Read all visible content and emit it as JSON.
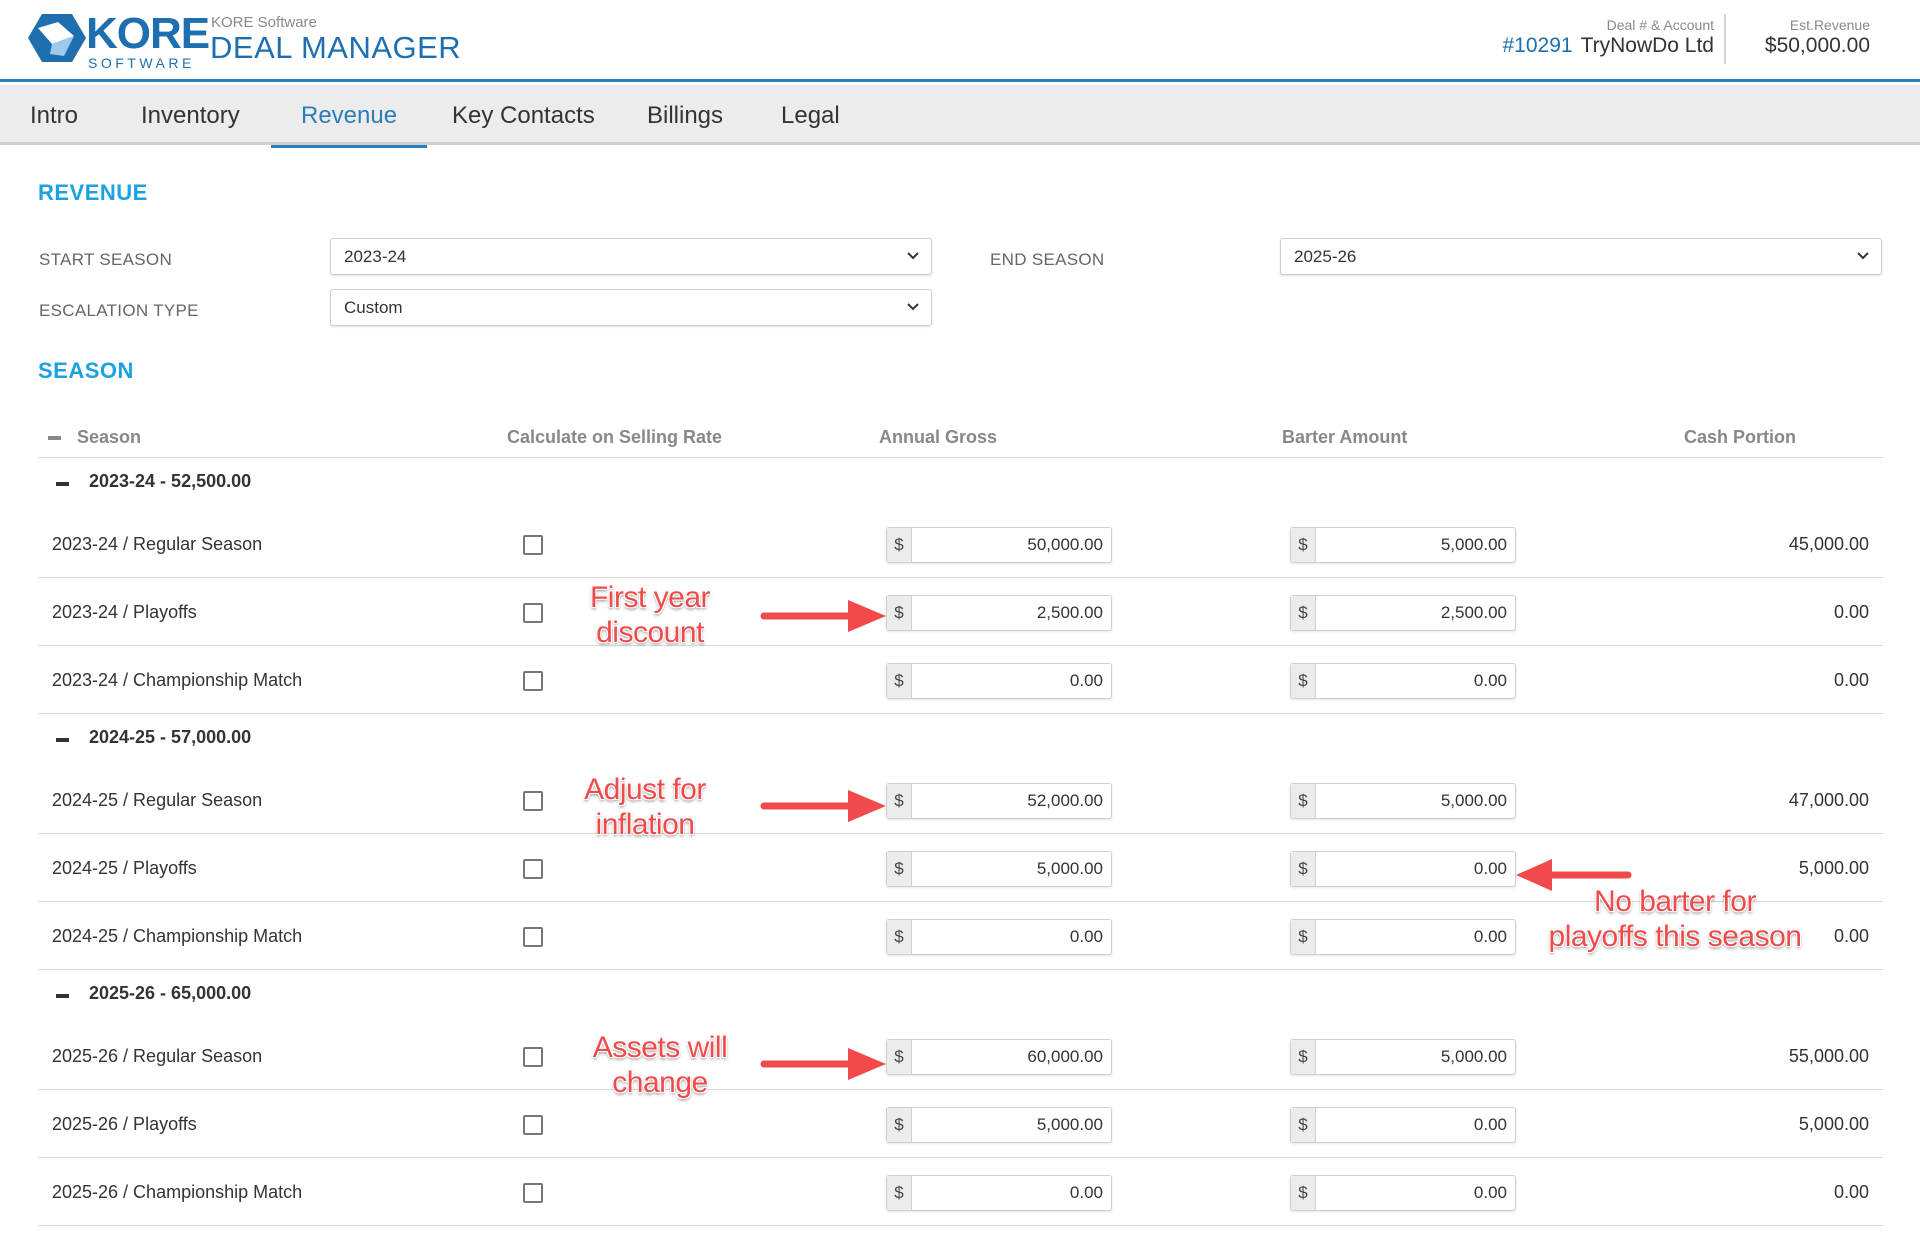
{
  "header": {
    "logo_text": "KORE",
    "logo_sub": "SOFTWARE",
    "app_sub": "KORE Software",
    "app_title": "DEAL MANAGER",
    "deal_label": "Deal # & Account",
    "deal_number": "#10291",
    "deal_account": "TryNowDo Ltd",
    "revenue_label": "Est.Revenue",
    "revenue_value": "$50,000.00"
  },
  "tabs": [
    {
      "label": "Intro"
    },
    {
      "label": "Inventory"
    },
    {
      "label": "Revenue",
      "active": true
    },
    {
      "label": "Key Contacts"
    },
    {
      "label": "Billings"
    },
    {
      "label": "Legal"
    }
  ],
  "revenue": {
    "title": "REVENUE",
    "start_season_label": "START SEASON",
    "start_season_value": "2023-24",
    "end_season_label": "END SEASON",
    "end_season_value": "2025-26",
    "escalation_label": "ESCALATION TYPE",
    "escalation_value": "Custom"
  },
  "season": {
    "title": "SEASON",
    "columns": {
      "season": "Season",
      "calc": "Calculate on Selling Rate",
      "gross": "Annual Gross",
      "barter": "Barter Amount",
      "cash": "Cash Portion"
    },
    "currency": "$",
    "groups": [
      {
        "label": "2023-24 - 52,500.00",
        "rows": [
          {
            "name": "2023-24 / Regular Season",
            "gross": "50,000.00",
            "barter": "5,000.00",
            "cash": "45,000.00"
          },
          {
            "name": "2023-24 / Playoffs",
            "gross": "2,500.00",
            "barter": "2,500.00",
            "cash": "0.00"
          },
          {
            "name": "2023-24 / Championship Match",
            "gross": "0.00",
            "barter": "0.00",
            "cash": "0.00"
          }
        ]
      },
      {
        "label": "2024-25 - 57,000.00",
        "rows": [
          {
            "name": "2024-25 / Regular Season",
            "gross": "52,000.00",
            "barter": "5,000.00",
            "cash": "47,000.00"
          },
          {
            "name": "2024-25 / Playoffs",
            "gross": "5,000.00",
            "barter": "0.00",
            "cash": "5,000.00"
          },
          {
            "name": "2024-25 / Championship Match",
            "gross": "0.00",
            "barter": "0.00",
            "cash": "0.00"
          }
        ]
      },
      {
        "label": "2025-26 - 65,000.00",
        "rows": [
          {
            "name": "2025-26 / Regular Season",
            "gross": "60,000.00",
            "barter": "5,000.00",
            "cash": "55,000.00"
          },
          {
            "name": "2025-26 / Playoffs",
            "gross": "5,000.00",
            "barter": "0.00",
            "cash": "5,000.00"
          },
          {
            "name": "2025-26 / Championship Match",
            "gross": "0.00",
            "barter": "0.00",
            "cash": "0.00"
          }
        ]
      }
    ]
  },
  "annotations": {
    "first_year": {
      "line1": "First year",
      "line2": "discount"
    },
    "inflation": {
      "line1": "Adjust for",
      "line2": "inflation"
    },
    "assets": {
      "line1": "Assets will",
      "line2": "change"
    },
    "no_barter": {
      "line1": "No barter for",
      "line2": "playoffs this season"
    },
    "color": "#f04a4a"
  },
  "colors": {
    "brand": "#1e6fb0",
    "accent": "#1da1e0",
    "tab_active": "#2b7fb8"
  }
}
